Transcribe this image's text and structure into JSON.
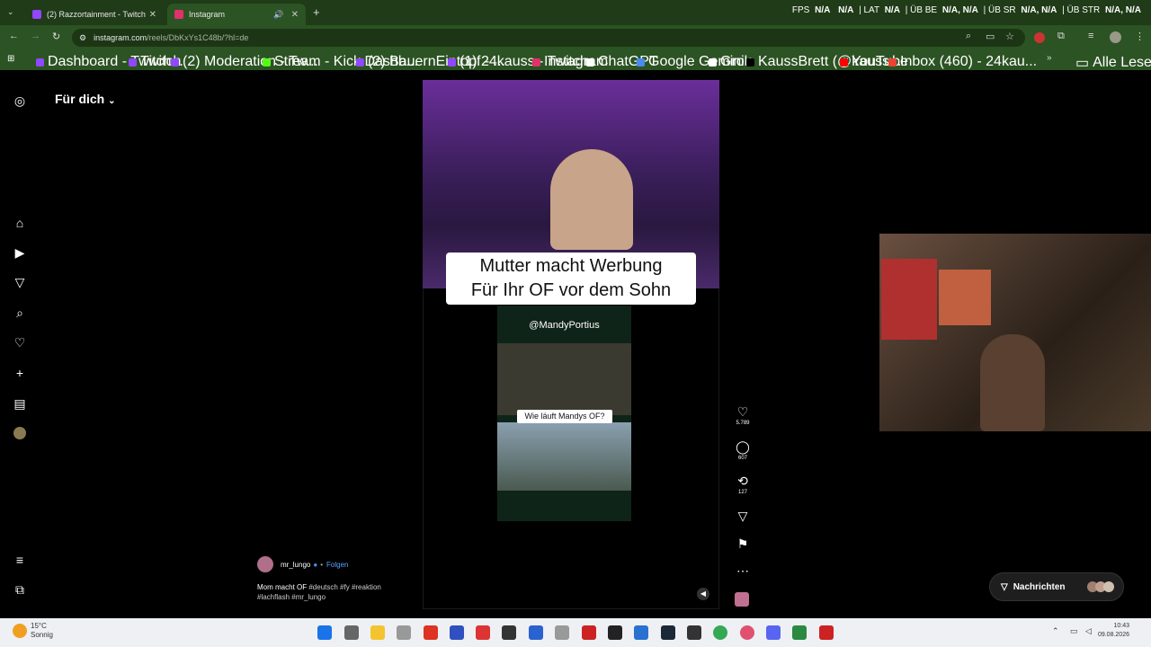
{
  "tabs": [
    {
      "label": "(2) Razzortainment - Twitch",
      "fav": "#9146ff"
    },
    {
      "label": "Instagram",
      "fav": "#e1306c"
    }
  ],
  "stats": {
    "fps_label": "FPS",
    "fps": "N/A",
    "fps2": "N/A",
    "lat_label": "LAT",
    "lat": "N/A",
    "ub_label": "ÜB BE",
    "ub": "N/A, N/A",
    "sr_label": "ÜB SR",
    "sr": "N/A, N/A",
    "str_label": "ÜB STR",
    "str": "N/A, N/A"
  },
  "url": {
    "host": "instagram.com",
    "path": "/reels/DbKxYs1C48b/?hl=de"
  },
  "bookmarks": [
    {
      "label": "Dashboard - Twitch...",
      "color": "#9146ff"
    },
    {
      "label": "Twitch",
      "color": "#9146ff"
    },
    {
      "label": "(2) Moderation - Tw...",
      "color": "#9146ff"
    },
    {
      "label": "Stream - Kick Dashb...",
      "color": "#53fc18"
    },
    {
      "label": "(2) BauernEintopf - ...",
      "color": "#9146ff"
    },
    {
      "label": "(1) 24kauss - Twitch",
      "color": "#9146ff"
    },
    {
      "label": "Instagram",
      "color": "#e1306c"
    },
    {
      "label": "ChatGPT",
      "color": "#ffffff"
    },
    {
      "label": "Google Gemini",
      "color": "#4a8af4"
    },
    {
      "label": "Grok",
      "color": "#ffffff"
    },
    {
      "label": "KaussBrett (@kauss...",
      "color": "#000000"
    },
    {
      "label": "YouTube",
      "color": "#ff0000"
    },
    {
      "label": "Inbox (460) - 24kau...",
      "color": "#ea4335"
    }
  ],
  "bookmarks_folder": "Alle Lesezeichen",
  "feed_title": "Für dich",
  "video": {
    "caption_line1": "Mutter macht Werbung",
    "caption_line2": "Für Ihr OF vor dem Sohn",
    "handle": "@MandyPortius",
    "inner_caption": "Wie läuft Mandys OF?"
  },
  "actions": {
    "likes": "5.789",
    "comments": "607",
    "reposts": "127"
  },
  "author": {
    "name": "mr_lungo",
    "follow": "Folgen",
    "separator": "•"
  },
  "description": {
    "text": "Mom macht OF",
    "tags": "#deutsch #fy #reaktion #lachflash #mr_lungo"
  },
  "messages_label": "Nachrichten",
  "weather": {
    "temp": "15°C",
    "cond": "Sonnig"
  },
  "clock": {
    "time": "10:43",
    "date": "09.08.2026"
  }
}
